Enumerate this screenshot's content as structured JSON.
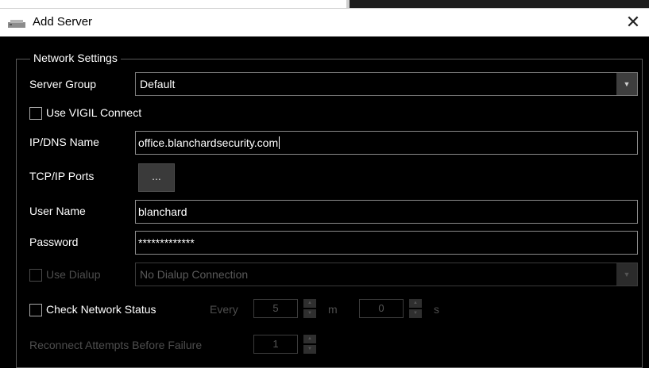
{
  "dialog": {
    "title": "Add Server",
    "icon": "server-icon",
    "close_glyph": "✕"
  },
  "group": {
    "legend": "Network Settings"
  },
  "fields": {
    "server_group": {
      "label": "Server Group",
      "value": "Default"
    },
    "use_vigil_connect": {
      "label": "Use VIGIL Connect",
      "checked": false
    },
    "ip_dns": {
      "label": "IP/DNS Name",
      "value": "office.blanchardsecurity.com"
    },
    "tcp_ports": {
      "label": "TCP/IP Ports",
      "button": "..."
    },
    "user_name": {
      "label": "User Name",
      "value": "blanchard"
    },
    "password": {
      "label": "Password",
      "value": "*************"
    },
    "use_dialup": {
      "label": "Use Dialup",
      "checked": false,
      "value": "No Dialup Connection"
    },
    "check_network": {
      "label": "Check Network Status",
      "checked": false,
      "every_label": "Every",
      "minutes_value": "5",
      "minutes_unit": "m",
      "seconds_value": "0",
      "seconds_unit": "s"
    },
    "reconnect": {
      "label": "Reconnect Attempts Before Failure",
      "value": "1"
    }
  },
  "colors": {
    "background": "#000000",
    "text": "#ffffff",
    "disabled_text": "#4e4e4e",
    "titlebar": "#ffffff"
  }
}
